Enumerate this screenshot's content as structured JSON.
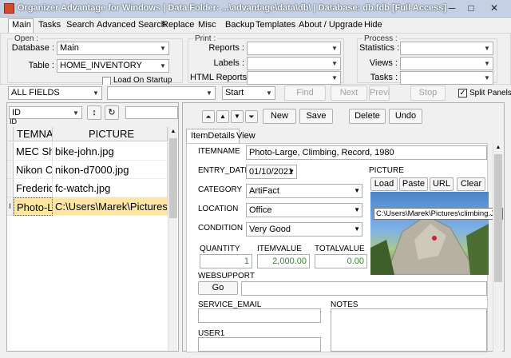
{
  "window": {
    "title": "Organizer Advantage for Windows | Data Folder: ...\\advantage\\data\\db\\ | Database: db.fdb [Full Access]",
    "min": "─",
    "max": "□",
    "close": "✕"
  },
  "menu": [
    "Main",
    "Tasks",
    "Search",
    "Advanced Search",
    "Replace",
    "Misc",
    "Backup",
    "Templates",
    "About / Upgrade",
    "Hide"
  ],
  "ribbon": {
    "open": {
      "title": "Open :",
      "database_label": "Database :",
      "database_value": "Main",
      "table_label": "Table :",
      "table_value": "HOME_INVENTORY",
      "load_on_startup": "Load On Startup"
    },
    "print": {
      "title": "Print :",
      "reports_label": "Reports :",
      "labels_label": "Labels :",
      "html_reports_label": "HTML Reports :"
    },
    "process": {
      "title": "Process :",
      "statistics_label": "Statistics :",
      "views_label": "Views :",
      "tasks_label": "Tasks :"
    }
  },
  "searchbar": {
    "field": "ALL FIELDS",
    "mode": "Start",
    "find": "Find",
    "next": "Next",
    "prev": "Previ",
    "stop": "Stop",
    "split_panels": "Split Panels"
  },
  "leftpane": {
    "sort_field": "ID",
    "id_caption": "ID",
    "sort_icon": "↕",
    "refresh_icon": "↻",
    "columns": [
      "TEMNAME",
      "PICTURE"
    ],
    "rows": [
      {
        "name": "MEC Sha",
        "picture": "bike-john.jpg"
      },
      {
        "name": "Nikon Ca",
        "picture": "nikon-d7000.jpg"
      },
      {
        "name": "Frederiqu",
        "picture": "fc-watch.jpg"
      },
      {
        "name": "Photo-La",
        "picture": "C:\\Users\\Marek\\Pictures\\cli"
      }
    ],
    "selected_indicator": "I"
  },
  "rightpane": {
    "nav": [
      "⏶",
      "▲",
      "▼",
      "⏷"
    ],
    "new": "New",
    "save": "Save",
    "delete": "Delete",
    "undo": "Undo",
    "tabs": [
      "ItemDetails",
      "View"
    ],
    "fields": {
      "itemname_label": "ITEMNAME",
      "itemname": "Photo-Large, Climbing, Record, 1980",
      "entry_date_label": "ENTRY_DATE",
      "entry_date": "01/10/2021",
      "category_label": "CATEGORY",
      "category": "ArtiFact",
      "location_label": "LOCATION",
      "location": "Office",
      "condition_label": "CONDITION",
      "condition": "Very Good",
      "quantity_label": "QUANTITY",
      "quantity": "1",
      "itemvalue_label": "ITEMVALUE",
      "itemvalue": "2,000.00",
      "totalvalue_label": "TOTALVALUE",
      "totalvalue": "0.00",
      "websupport_label": "WEBSUPPORT",
      "go": "Go",
      "service_email_label": "SERVICE_EMAIL",
      "notes_label": "NOTES",
      "user1_label": "USER1",
      "picture_label": "PICTURE",
      "picture_buttons": [
        "Load",
        "Paste",
        "URL",
        "Clear"
      ],
      "picture_tooltip": "C:\\Users\\Marek\\Pictures\\climbing.JPG"
    }
  },
  "colors": {
    "selected_row": "#fde7a3",
    "number_text": "#2a8a2a"
  }
}
